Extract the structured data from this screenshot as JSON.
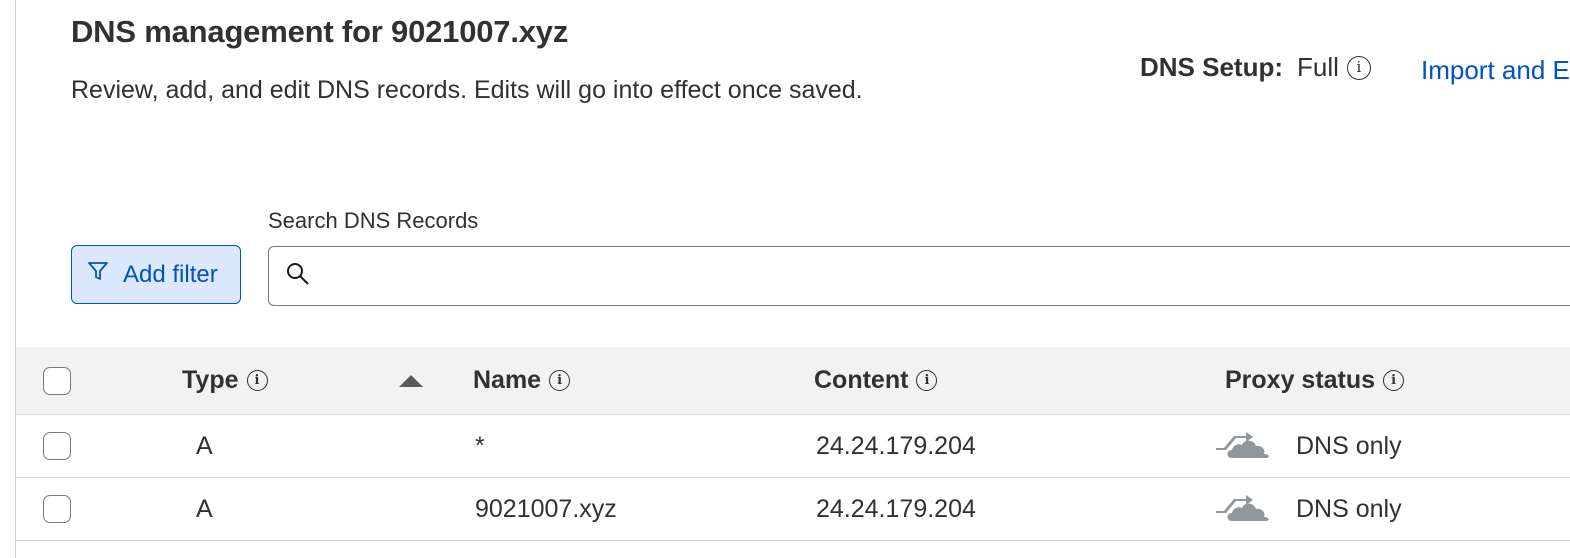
{
  "header": {
    "title_prefix": "DNS management for ",
    "domain": "9021007.xyz",
    "description": "Review, add, and edit DNS records. Edits will go into effect once saved."
  },
  "dns_setup": {
    "label": "DNS Setup:",
    "value": "Full",
    "info_icon": "info-icon"
  },
  "import_link": "Import and Export",
  "toolbar": {
    "add_filter_label": "Add filter",
    "filter_icon": "filter-icon",
    "search_label": "Search DNS Records",
    "search_value": "",
    "search_placeholder": "",
    "search_icon": "search-icon"
  },
  "table": {
    "columns": [
      {
        "key": "type",
        "label": "Type",
        "info": true
      },
      {
        "key": "name",
        "label": "Name",
        "info": true,
        "sorted": "ascending"
      },
      {
        "key": "content",
        "label": "Content",
        "info": true
      },
      {
        "key": "proxy",
        "label": "Proxy status",
        "info": true
      }
    ],
    "rows": [
      {
        "type": "A",
        "name": "*",
        "content": "24.24.179.204",
        "proxy_status": "DNS only",
        "proxy_icon": "dns-only-cloud-icon",
        "checked": false
      },
      {
        "type": "A",
        "name": "9021007.xyz",
        "content": "24.24.179.204",
        "proxy_status": "DNS only",
        "proxy_icon": "dns-only-cloud-icon",
        "checked": false
      }
    ]
  },
  "colors": {
    "link": "#0051c3",
    "button_bg": "#dbe8fd",
    "text": "#313131",
    "header_bg": "#f2f2f2",
    "proxy_icon": "#92979b"
  }
}
